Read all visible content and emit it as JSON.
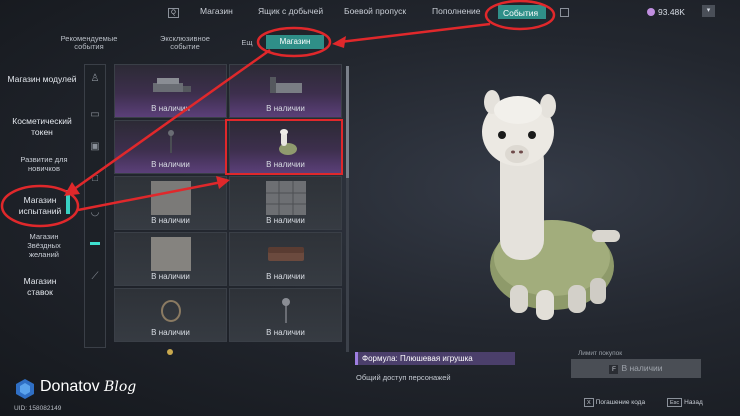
{
  "topnav": {
    "q_key": "Q",
    "items": [
      "Магазин",
      "Ящик с добычей",
      "Боевой пропуск",
      "Пополнение"
    ],
    "active": "События",
    "currency": "93.48K"
  },
  "subtabs": {
    "recommended": "Рекомендуемые события",
    "exclusive": "Эксклюзивное событие",
    "truncated": "Ещ",
    "active": "Магазин"
  },
  "sidebar": {
    "items": [
      {
        "label": "Магазин модулей"
      },
      {
        "label": "Косметический токен"
      },
      {
        "label": "Развитие для новичков"
      },
      {
        "label": "Магазин испытаний"
      },
      {
        "label": "Магазин Звёздных желаний"
      },
      {
        "label": "Магазин ставок"
      }
    ],
    "active_index": 3
  },
  "grid": {
    "available_label": "В наличии",
    "tiles": [
      {
        "status": "В наличии",
        "style": "purple",
        "item": "sofa-table"
      },
      {
        "status": "В наличии",
        "style": "purple",
        "item": "bed"
      },
      {
        "status": "В наличии",
        "style": "purple",
        "item": "lamp"
      },
      {
        "status": "В наличии",
        "style": "purple",
        "item": "alpaca"
      },
      {
        "status": "В наличии",
        "style": "grey",
        "item": "rug"
      },
      {
        "status": "В наличии",
        "style": "grey",
        "item": "wall-panel"
      },
      {
        "status": "В наличии",
        "style": "grey",
        "item": "carpet"
      },
      {
        "status": "В наличии",
        "style": "grey",
        "item": "couch"
      },
      {
        "status": "В наличии",
        "style": "grey",
        "item": "hanging-chair"
      },
      {
        "status": "В наличии",
        "style": "grey",
        "item": "floor-lamp"
      }
    ]
  },
  "detail": {
    "formula": "Формула: Плюшевая игрушка",
    "description": "Общий доступ персонажей",
    "limit_label": "Лимит покупок",
    "buy_key": "F",
    "buy_label": "В наличии"
  },
  "footer": {
    "x_key": "X",
    "redeem": "Погашение кода",
    "esc_key": "Esc",
    "back": "Назад",
    "uid": "UID: 158082149"
  },
  "watermark": {
    "brand": "Donatov",
    "blog": "Blog"
  },
  "colors": {
    "accent": "#2f8f88",
    "annotation": "#e0282b",
    "formula_bg": "#4b3f6b"
  }
}
